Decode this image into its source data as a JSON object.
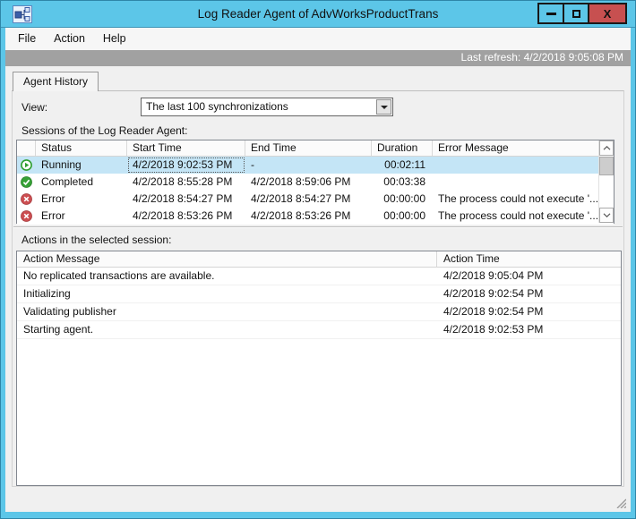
{
  "window": {
    "title": "Log Reader Agent of AdvWorksProductTrans",
    "close_glyph": "X"
  },
  "menu": {
    "items": [
      "File",
      "Action",
      "Help"
    ]
  },
  "refresh_bar": {
    "last_refresh": "Last refresh: 4/2/2018 9:05:08 PM"
  },
  "tabs": [
    {
      "label": "Agent History"
    }
  ],
  "view": {
    "label": "View:",
    "selected": "The last 100 synchronizations"
  },
  "sessions": {
    "label": "Sessions of the Log Reader Agent:",
    "columns": [
      "Status",
      "Start Time",
      "End Time",
      "Duration",
      "Error Message"
    ],
    "rows": [
      {
        "icon": "running",
        "status": "Running",
        "start": "4/2/2018 9:02:53 PM",
        "end": "-",
        "duration": "00:02:11",
        "error": "",
        "selected": true
      },
      {
        "icon": "completed",
        "status": "Completed",
        "start": "4/2/2018 8:55:28 PM",
        "end": "4/2/2018 8:59:06 PM",
        "duration": "00:03:38",
        "error": "",
        "selected": false
      },
      {
        "icon": "error",
        "status": "Error",
        "start": "4/2/2018 8:54:27 PM",
        "end": "4/2/2018 8:54:27 PM",
        "duration": "00:00:00",
        "error": "The process could not execute '...",
        "selected": false
      },
      {
        "icon": "error",
        "status": "Error",
        "start": "4/2/2018 8:53:26 PM",
        "end": "4/2/2018 8:53:26 PM",
        "duration": "00:00:00",
        "error": "The process could not execute '...",
        "selected": false
      }
    ]
  },
  "actions": {
    "label": "Actions in the selected session:",
    "columns": [
      "Action Message",
      "Action Time"
    ],
    "rows": [
      {
        "message": "No replicated transactions are available.",
        "time": "4/2/2018 9:05:04 PM"
      },
      {
        "message": "Initializing",
        "time": "4/2/2018 9:02:54 PM"
      },
      {
        "message": "Validating publisher",
        "time": "4/2/2018 9:02:54 PM"
      },
      {
        "message": "Starting agent.",
        "time": "4/2/2018 9:02:53 PM"
      }
    ]
  },
  "colors": {
    "titlebar_blue": "#5CC6E8",
    "close_red": "#C75050",
    "refresh_bar_gray": "#A1A1A1",
    "selected_row": "#C4E5F6",
    "running_green": "#2F9E2F",
    "completed_green": "#36A136",
    "error_red": "#CC4E51"
  }
}
